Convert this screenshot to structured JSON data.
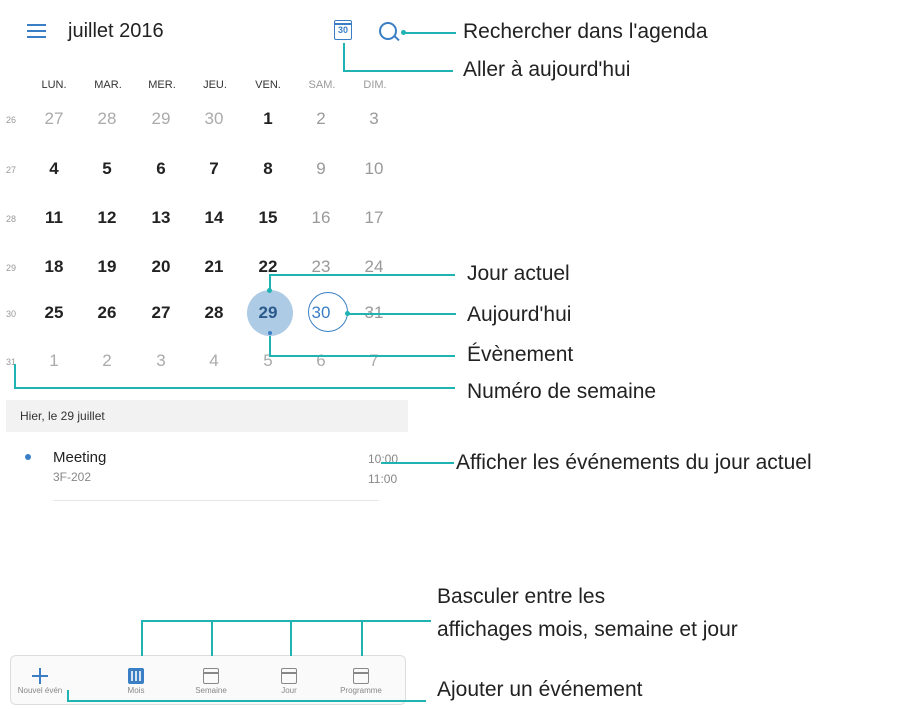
{
  "header": {
    "month_title": "juillet 2016",
    "today_icon_number": "30"
  },
  "weekdays": [
    "LUN.",
    "MAR.",
    "MER.",
    "JEU.",
    "VEN.",
    "SAM.",
    "DIM."
  ],
  "weeks": [
    {
      "number": "26",
      "days": [
        "27",
        "28",
        "29",
        "30",
        "1",
        "2",
        "3"
      ]
    },
    {
      "number": "27",
      "days": [
        "4",
        "5",
        "6",
        "7",
        "8",
        "9",
        "10"
      ]
    },
    {
      "number": "28",
      "days": [
        "11",
        "12",
        "13",
        "14",
        "15",
        "16",
        "17"
      ]
    },
    {
      "number": "29",
      "days": [
        "18",
        "19",
        "20",
        "21",
        "22",
        "23",
        "24"
      ]
    },
    {
      "number": "30",
      "days": [
        "25",
        "26",
        "27",
        "28",
        "29",
        "30",
        "31"
      ]
    },
    {
      "number": "31",
      "days": [
        "1",
        "2",
        "3",
        "4",
        "5",
        "6",
        "7"
      ]
    }
  ],
  "agenda": {
    "date_header": "Hier, le 29 juillet",
    "events": [
      {
        "title": "Meeting",
        "location": "3F-202",
        "start": "10:00",
        "end": "11:00"
      }
    ]
  },
  "tabbar": {
    "items": [
      {
        "label": "Nouvel évén",
        "icon": "plus-icon"
      },
      {
        "label": "Mois",
        "icon": "month-grid-icon"
      },
      {
        "label": "Semaine",
        "icon": "week-icon"
      },
      {
        "label": "Jour",
        "icon": "day-icon"
      },
      {
        "label": "Programme",
        "icon": "agenda-icon"
      }
    ]
  },
  "annotations": {
    "search": "Rechercher dans l'agenda",
    "today_button": "Aller à aujourd'hui",
    "current_day": "Jour actuel",
    "today": "Aujourd'hui",
    "event": "Évènement",
    "week_number": "Numéro de semaine",
    "show_events": "Afficher les événements du jour actuel",
    "switch_views_line1": "Basculer entre les",
    "switch_views_line2": "affichages mois, semaine et jour",
    "add_event": "Ajouter un événement"
  },
  "colors": {
    "accent": "#3a7fc6",
    "selected_day": "#aecbe6",
    "callout": "#1fb3b3"
  }
}
